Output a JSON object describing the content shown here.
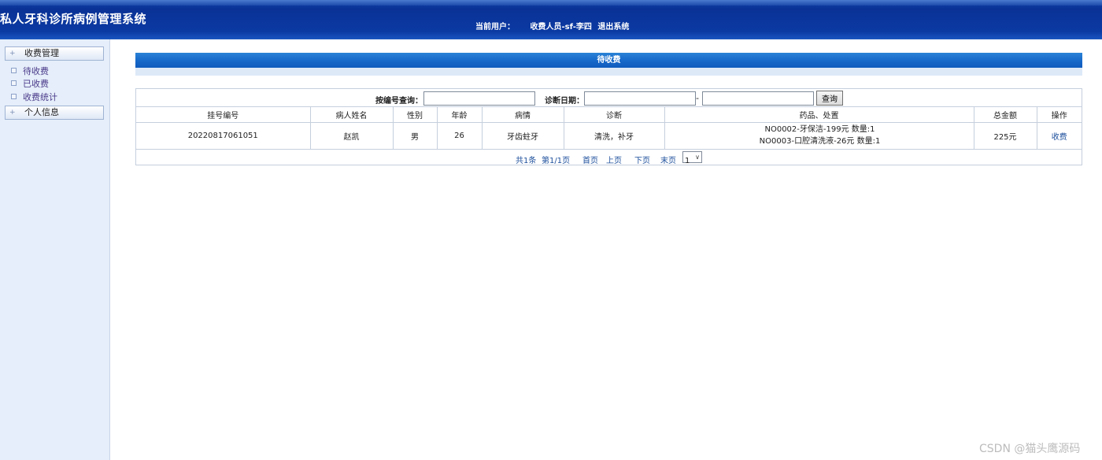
{
  "header": {
    "app_title": "私人牙科诊所病例管理系统",
    "current_user_label": "当前用户：",
    "current_user": "收费人员-sf-李四",
    "logout": "退出系统"
  },
  "sidebar": {
    "groups": [
      {
        "label": "收费管理",
        "items": [
          "待收费",
          "已收费",
          "收费统计"
        ]
      },
      {
        "label": "个人信息",
        "items": []
      }
    ]
  },
  "panel": {
    "title": "待收费"
  },
  "search": {
    "code_label": "按编号查询：",
    "code_value": "",
    "date_label": "诊断日期：",
    "date_from": "",
    "date_sep": "-",
    "date_to": "",
    "query_button": "查询"
  },
  "table": {
    "columns": [
      "挂号编号",
      "病人姓名",
      "性别",
      "年龄",
      "病情",
      "诊断",
      "药品、处置",
      "总金额",
      "操作"
    ],
    "rows": [
      {
        "reg_no": "20220817061051",
        "name": "赵凯",
        "gender": "男",
        "age": "26",
        "condition": "牙齿蛀牙",
        "diagnosis": "清洗，补牙",
        "rx_line1": "NO0002-牙保洁-199元  数量:1",
        "rx_line2": "NO0003-口腔清洗液-26元  数量:1",
        "total": "225元",
        "action": "收费"
      }
    ]
  },
  "pager": {
    "total": "共1条",
    "page": "第1/1页",
    "first": "首页",
    "prev": "上页",
    "next": "下页",
    "last": "末页",
    "current": "1"
  },
  "watermark": "CSDN @猫头鹰源码"
}
